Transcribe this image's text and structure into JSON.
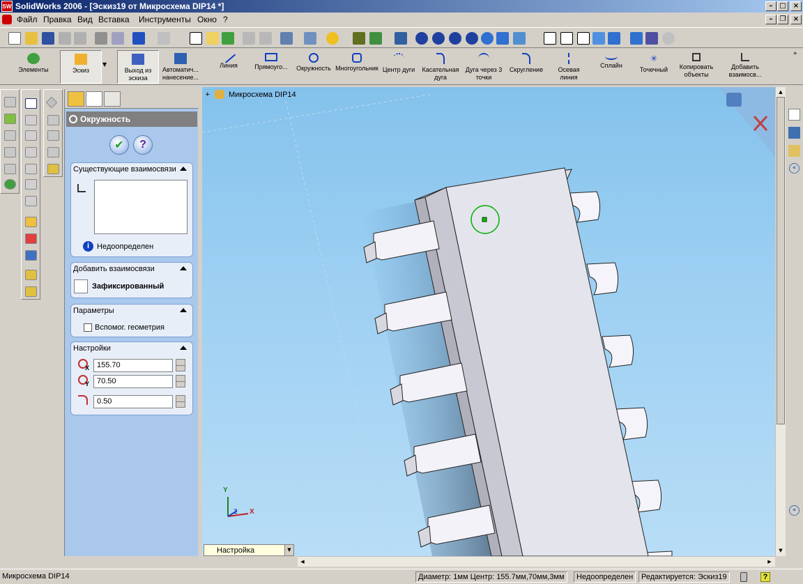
{
  "window": {
    "title": "SolidWorks 2006 - [Эскиз19 от Микросхема DIP14 *]",
    "app_icon": "SW"
  },
  "menu": [
    "Файл",
    "Правка",
    "Вид",
    "Вставка",
    "Инструменты",
    "Окно",
    "?"
  ],
  "sketch_toolbar": [
    {
      "label": "Элементы"
    },
    {
      "label": "Эскиз"
    },
    {
      "label": "Выход из эскиза"
    },
    {
      "label": "Автоматич... нанесение..."
    },
    {
      "label": "Линия"
    },
    {
      "label": "Прямоуго..."
    },
    {
      "label": "Окружность"
    },
    {
      "label": "Многоугольник"
    },
    {
      "label": "Центр дуги"
    },
    {
      "label": "Касательная дуга"
    },
    {
      "label": "Дуга через 3 точки"
    },
    {
      "label": "Скругление"
    },
    {
      "label": "Осевая линия"
    },
    {
      "label": "Сплайн"
    },
    {
      "label": "Точечный"
    },
    {
      "label": "Копировать объекты"
    },
    {
      "label": "Добавить взаимосв..."
    }
  ],
  "property_manager": {
    "title": "Окружность",
    "ok_button": "✔",
    "help_button": "?",
    "existing_relations": {
      "title": "Существующие взаимосвязи",
      "status": "Недоопределен",
      "info_icon": "i"
    },
    "add_relations": {
      "title": "Добавить взаимосвязи",
      "item": "Зафиксированный"
    },
    "parameters": {
      "title": "Параметры",
      "checkbox_label": "Вспомог. геометрия",
      "checked": false
    },
    "settings": {
      "title": "Настройки",
      "center_x": "155.70",
      "center_y": "70.50",
      "radius": "0.50",
      "x_sub": "X",
      "y_sub": "Y"
    }
  },
  "viewport": {
    "tree_root": "Микросхема DIP14",
    "bottom_dropdown": "Настройка",
    "triad": {
      "x": "X",
      "y": "Y",
      "z": "Z"
    },
    "accent_circle": "#00b000"
  },
  "status_bar": {
    "document": "Микросхема DIP14",
    "measure": "Диаметр: 1мм  Центр: 155.7мм,70мм,3мм",
    "state": "Недоопределен",
    "editing": "Редактируется: Эскиз19",
    "help": "?"
  }
}
